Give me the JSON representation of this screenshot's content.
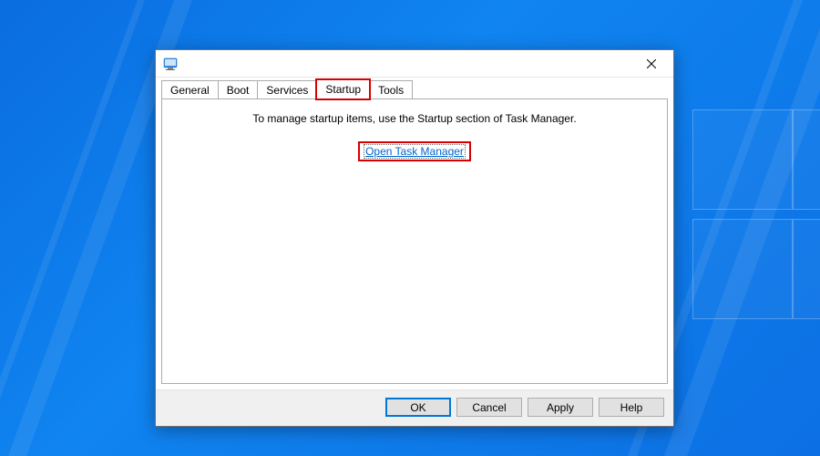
{
  "window": {
    "title": ""
  },
  "tabs": {
    "general": "General",
    "boot": "Boot",
    "services": "Services",
    "startup": "Startup",
    "tools": "Tools",
    "active": "startup"
  },
  "content": {
    "info_text": "To manage startup items, use the Startup section of Task Manager.",
    "link_text": "Open Task Manager"
  },
  "buttons": {
    "ok": "OK",
    "cancel": "Cancel",
    "apply": "Apply",
    "help": "Help"
  }
}
